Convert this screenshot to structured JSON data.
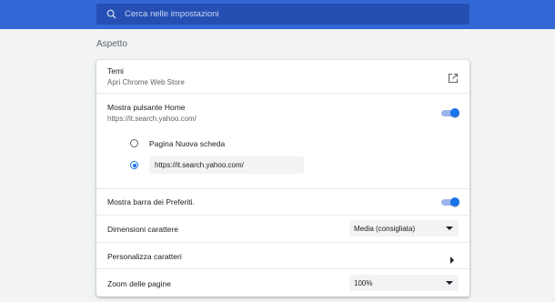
{
  "search": {
    "placeholder": "Cerca nelle impostazioni",
    "icon": "search-icon"
  },
  "section": {
    "title": "Aspetto"
  },
  "settings": {
    "temi": {
      "label": "Temi",
      "sublabel": "Apri Chrome Web Store",
      "icon": "external-link-icon"
    },
    "home_button": {
      "label": "Mostra pulsante Home",
      "sublabel": "https://it.search.yahoo.com/",
      "enabled": true,
      "options": [
        {
          "label": "Pagina Nuova scheda",
          "selected": false
        },
        {
          "value": "https://it.search.yahoo.com/",
          "selected": true
        }
      ]
    },
    "bookmarks_bar": {
      "label": "Mostra barra dei Preferiti.",
      "enabled": true
    },
    "font_size": {
      "label": "Dimensioni carattere",
      "value": "Media (consigliata)"
    },
    "customize_fonts": {
      "label": "Personalizza caratteri",
      "icon": "chevron-right-icon"
    },
    "page_zoom": {
      "label": "Zoom delle pagine",
      "value": "100%"
    }
  },
  "colors": {
    "accent": "#1a73e8",
    "header": "#3367d6",
    "search_bg": "#254fb3"
  }
}
